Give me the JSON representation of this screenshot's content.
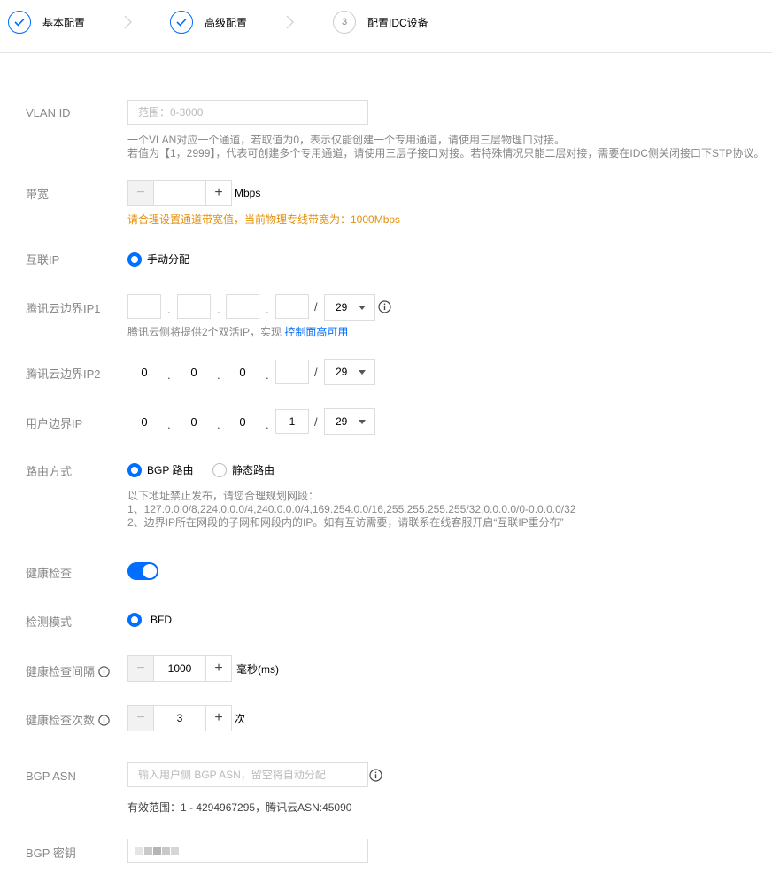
{
  "steps": [
    {
      "label": "基本配置",
      "state": "done"
    },
    {
      "label": "高级配置",
      "state": "done"
    },
    {
      "label": "配置IDC设备",
      "state": "current",
      "number": "3"
    }
  ],
  "vlan": {
    "label": "VLAN ID",
    "placeholder": "范围：0-3000",
    "hint1": "一个VLAN对应一个通道，若取值为0，表示仅能创建一个专用通道，请使用三层物理口对接。",
    "hint2": "若值为【1，2999】，代表可创建多个专用通道，请使用三层子接口对接。若特殊情况只能二层对接，需要在IDC侧关闭接口下STP协议。"
  },
  "bandwidth": {
    "label": "带宽",
    "value": "",
    "unit": "Mbps",
    "warning": "请合理设置通道带宽值，当前物理专线带宽为：1000Mbps"
  },
  "interconnect_ip": {
    "label": "互联IP",
    "option": "手动分配"
  },
  "tencent_ip1": {
    "label": "腾讯云边界IP1",
    "octets": [
      "",
      "",
      "",
      ""
    ],
    "mask": "29",
    "hint_prefix": "腾讯云侧将提供2个双活IP，实现 ",
    "hint_link": "控制面高可用"
  },
  "tencent_ip2": {
    "label": "腾讯云边界IP2",
    "octets": [
      "0",
      "0",
      "0",
      ""
    ],
    "mask": "29"
  },
  "user_ip": {
    "label": "用户边界IP",
    "octets": [
      "0",
      "0",
      "0",
      "1"
    ],
    "mask": "29"
  },
  "routing": {
    "label": "路由方式",
    "options": [
      "BGP 路由",
      "静态路由"
    ],
    "selected": "BGP 路由",
    "hint1": "以下地址禁止发布，请您合理规划网段：",
    "hint2": "1、127.0.0.0/8,224.0.0.0/4,240.0.0.0/4,169.254.0.0/16,255.255.255.255/32,0.0.0.0/0-0.0.0.0/32",
    "hint3": "2、边界IP所在网段的子网和网段内的IP。如有互访需要，请联系在线客服开启“互联IP重分布”"
  },
  "health_check": {
    "label": "健康检查",
    "enabled": true
  },
  "detect_mode": {
    "label": "检测模式",
    "option": "BFD"
  },
  "check_interval": {
    "label": "健康检查间隔",
    "value": "1000",
    "unit": "毫秒(ms)"
  },
  "check_count": {
    "label": "健康检查次数",
    "value": "3",
    "unit": "次"
  },
  "bgp_asn": {
    "label": "BGP ASN",
    "placeholder": "输入用户侧 BGP ASN，留空将自动分配",
    "hint": "有效范围：1 - 4294967295，腾讯云ASN:45090"
  },
  "bgp_key": {
    "label": "BGP 密钥"
  },
  "colors": {
    "primary": "#006eff",
    "warning": "#e5900d",
    "muted": "#888888"
  }
}
